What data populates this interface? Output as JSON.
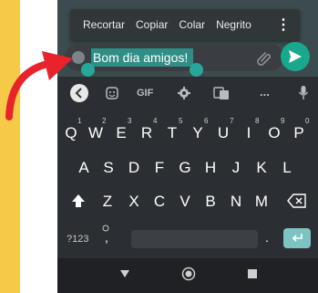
{
  "context_menu": {
    "items": [
      "Recortar",
      "Copiar",
      "Colar",
      "Negrito"
    ]
  },
  "composer": {
    "selected_text": "Bom dia amigos!"
  },
  "toolbar": {
    "gif_label": "GIF",
    "more_label": "..."
  },
  "keyboard": {
    "row1": [
      {
        "key": "Q",
        "num": "1"
      },
      {
        "key": "W",
        "num": "2"
      },
      {
        "key": "E",
        "num": "3"
      },
      {
        "key": "R",
        "num": "4"
      },
      {
        "key": "T",
        "num": "5"
      },
      {
        "key": "Y",
        "num": "6"
      },
      {
        "key": "U",
        "num": "7"
      },
      {
        "key": "I",
        "num": "8"
      },
      {
        "key": "O",
        "num": "9"
      },
      {
        "key": "P",
        "num": "0"
      }
    ],
    "row2": [
      "A",
      "S",
      "D",
      "F",
      "G",
      "H",
      "J",
      "K",
      "L"
    ],
    "row3": [
      "Z",
      "X",
      "C",
      "V",
      "B",
      "N",
      "M"
    ],
    "symbols_label": "?123",
    "comma_label": ",",
    "period_label": "."
  },
  "colors": {
    "accent": "#19a88c",
    "selection": "#2f8e85",
    "keyboard_bg": "#2b2e32",
    "arrow": "#e8232b",
    "side_bar": "#f7c948"
  },
  "icons": [
    "emoji-icon",
    "paperclip-icon",
    "send-icon",
    "back-icon",
    "sticker-icon",
    "settings-icon",
    "translate-icon",
    "mic-icon",
    "shift-icon",
    "backspace-icon",
    "enter-icon",
    "nav-back-icon",
    "nav-home-icon",
    "nav-recents-icon"
  ]
}
